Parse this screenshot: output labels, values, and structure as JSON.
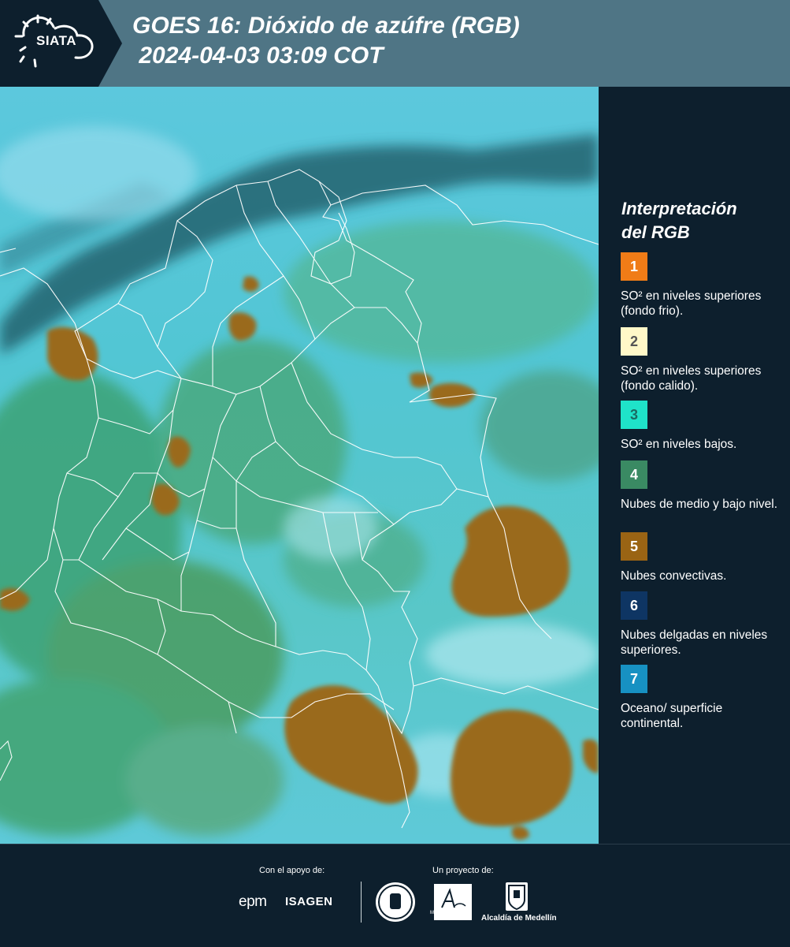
{
  "header": {
    "logo_text": "SIATA",
    "title_line1": "GOES 16: Dióxido de azúfre (RGB)",
    "title_line2": " 2024-04-03 03:09 COT"
  },
  "legend": {
    "title_line1": "Interpretación",
    "title_line2": "del RGB",
    "items": [
      {
        "number": "1",
        "color": "#f07c17",
        "text_color": "#ffffff",
        "label": "SO² en niveles superiores (fondo frio)."
      },
      {
        "number": "2",
        "color": "#fff8c8",
        "text_color": "#555555",
        "label": "SO² en niveles superiores (fondo calido)."
      },
      {
        "number": "3",
        "color": "#1fe3c9",
        "text_color": "#1a6b62",
        "label": "SO² en niveles bajos."
      },
      {
        "number": "4",
        "color": "#3a8a63",
        "text_color": "#ffffff",
        "label": "Nubes de medio y bajo nivel."
      },
      {
        "number": "5",
        "color": "#9a6414",
        "text_color": "#ffffff",
        "label": "Nubes convectivas."
      },
      {
        "number": "6",
        "color": "#0e3563",
        "text_color": "#ffffff",
        "label": "Nubes delgadas en niveles superiores."
      },
      {
        "number": "7",
        "color": "#1791c2",
        "text_color": "#ffffff",
        "label": "Oceano/ superficie continental."
      }
    ]
  },
  "footer": {
    "support_caption": "Con el apoyo de:",
    "project_caption": "Un proyecto de:",
    "epm": "epm",
    "isagen": "ISAGEN",
    "area_caption": "METROPOLITANA",
    "alcaldia": "Alcaldía de Medellín"
  }
}
